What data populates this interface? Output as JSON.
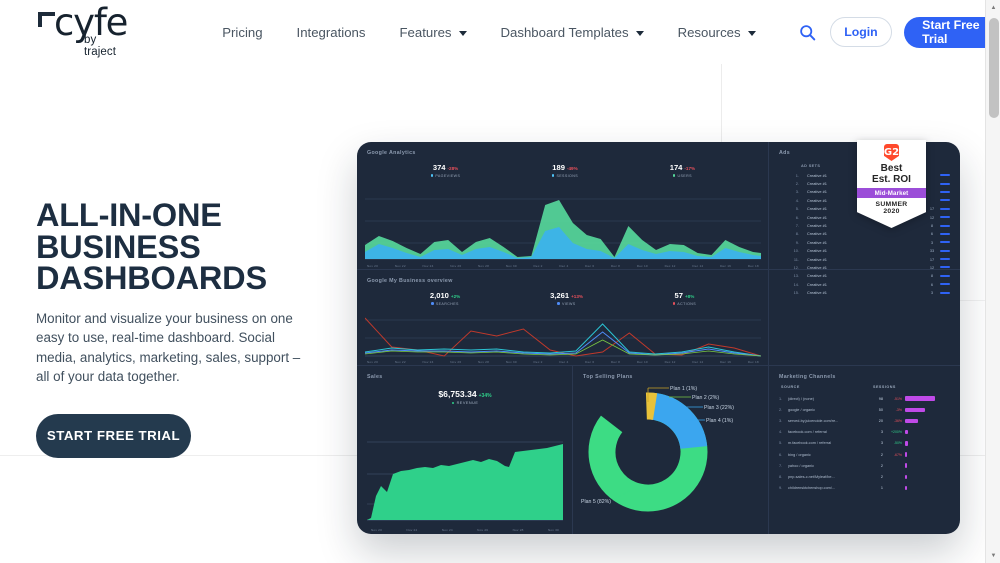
{
  "header": {
    "logo": {
      "text": "cyfe",
      "tagline": "by traject"
    },
    "nav": [
      {
        "label": "Pricing",
        "dropdown": false
      },
      {
        "label": "Integrations",
        "dropdown": false
      },
      {
        "label": "Features",
        "dropdown": true
      },
      {
        "label": "Dashboard Templates",
        "dropdown": true
      },
      {
        "label": "Resources",
        "dropdown": true
      }
    ],
    "search_icon": "search-icon",
    "login_label": "Login",
    "trial_label": "Start Free Trial",
    "trial_arrow": "→",
    "accent_color": "#2f62f5"
  },
  "hero": {
    "title_line1": "ALL-IN-ONE",
    "title_line2": "BUSINESS",
    "title_line3": "DASHBOARDS",
    "paragraph": "Monitor and visualize your business on one easy to use, real-time dashboard. Social media, analytics, marketing, sales, support – all of your data together.",
    "cta_label": "START FREE TRIAL",
    "cta_color": "#243a4e"
  },
  "badge": {
    "logo": "G2",
    "line1": "Best",
    "line2": "Est. ROI",
    "ribbon": "Mid-Market",
    "season": "SUMMER",
    "year": "2020",
    "ribbon_color": "#9b4dd8",
    "logo_color": "#ff492c"
  },
  "dashboard": {
    "background": "#1e293b",
    "google_analytics": {
      "title": "Google Analytics",
      "metrics": [
        {
          "value": "374",
          "change": "-28%",
          "direction": "down",
          "label": "PAGEVIEWS",
          "color": "#4fc3f7"
        },
        {
          "value": "189",
          "change": "-49%",
          "direction": "down",
          "label": "SESSIONS",
          "color": "#4fc3f7"
        },
        {
          "value": "174",
          "change": "-17%",
          "direction": "down",
          "label": "USERS",
          "color": "#56d79b"
        }
      ],
      "axis_labels": [
        "Nov 20",
        "Nov 22",
        "Nov 24",
        "Nov 26",
        "Nov 28",
        "Nov 30",
        "Dec 2",
        "Dec 4",
        "Dec 6",
        "Dec 8",
        "Dec 10",
        "Dec 12",
        "Dec 14",
        "Dec 16",
        "Dec 18"
      ]
    },
    "gmb": {
      "title": "Google My Business overview",
      "metrics": [
        {
          "value": "2,010",
          "change": "+2%",
          "direction": "up",
          "label": "SEARCHES",
          "color": "#4f8cf7"
        },
        {
          "value": "3,261",
          "change": "+13%",
          "direction": "up",
          "label": "VIEWS",
          "color": "#4f8cf7"
        },
        {
          "value": "57",
          "change": "+8%",
          "direction": "up",
          "label": "ACTIONS",
          "color": "#e8505b"
        }
      ],
      "axis_labels": [
        "Nov 20",
        "Nov 22",
        "Nov 24",
        "Nov 26",
        "Nov 28",
        "Nov 30",
        "Dec 2",
        "Dec 4",
        "Dec 6",
        "Dec 8",
        "Dec 10",
        "Dec 12",
        "Dec 14",
        "Dec 16",
        "Dec 18"
      ]
    },
    "ads": {
      "title": "Ads",
      "column_header": "AD SETS",
      "rows": [
        {
          "index": "1.",
          "name": "Creative #1",
          "count": ""
        },
        {
          "index": "2.",
          "name": "Creative #1",
          "count": ""
        },
        {
          "index": "3.",
          "name": "Creative #1",
          "count": ""
        },
        {
          "index": "4.",
          "name": "Creative #1",
          "count": ""
        },
        {
          "index": "5.",
          "name": "Creative #1",
          "count": "17"
        },
        {
          "index": "6.",
          "name": "Creative #1",
          "count": "12"
        },
        {
          "index": "7.",
          "name": "Creative #1",
          "count": "8"
        },
        {
          "index": "8.",
          "name": "Creative #1",
          "count": "6"
        },
        {
          "index": "9.",
          "name": "Creative #1",
          "count": "3"
        },
        {
          "index": "10.",
          "name": "Creative #1",
          "count": "33"
        },
        {
          "index": "11.",
          "name": "Creative #1",
          "count": "17"
        },
        {
          "index": "12.",
          "name": "Creative #1",
          "count": "12"
        },
        {
          "index": "13.",
          "name": "Creative #1",
          "count": "8"
        },
        {
          "index": "14.",
          "name": "Creative #1",
          "count": "6"
        },
        {
          "index": "15.",
          "name": "Creative #1",
          "count": "3"
        }
      ]
    },
    "sales": {
      "title": "Sales",
      "value": "$6,753.34",
      "change": "+34%",
      "direction": "up",
      "label": "REVENUE",
      "color": "#2fd08a",
      "axis_labels": [
        "Nov 20",
        "Nov 22",
        "Nov 24",
        "Nov 26",
        "Nov 28",
        "Nov 30"
      ]
    },
    "top_plans": {
      "title": "Top Selling  Plans",
      "labels": [
        {
          "text": "Plan 1 (1%)",
          "color": "#e8c23a"
        },
        {
          "text": "Plan 2 (2%)",
          "color": "#7ac943"
        },
        {
          "text": "Plan 3 (22%)",
          "color": "#3ba6ef"
        },
        {
          "text": "Plan 4 (1%)",
          "color": "#3ba6ef"
        },
        {
          "text": "Plan 5 (82%)",
          "color": "#3ddc84"
        }
      ]
    },
    "marketing": {
      "title": "Marketing  Channels",
      "col_source": "SOURCE",
      "col_sessions": "SESSIONS",
      "rows": [
        {
          "index": "1.",
          "source": "(direct) / (none)",
          "sessions": "98",
          "pct": "-51%",
          "direction": "down",
          "bar": 30
        },
        {
          "index": "2.",
          "source": "google / organic",
          "sessions": "50",
          "pct": "-3%",
          "direction": "down",
          "bar": 20
        },
        {
          "index": "3.",
          "source": "served-by.juicenoide.com/re...",
          "sessions": "20",
          "pct": "-36%",
          "direction": "down",
          "bar": 13
        },
        {
          "index": "4.",
          "source": "facebook.com / referral",
          "sessions": "3",
          "pct": "+200%",
          "direction": "up",
          "bar": 2.5
        },
        {
          "index": "5.",
          "source": "m.facebook.com / referral",
          "sessions": "3",
          "pct": "-50%",
          "direction": "down",
          "bar": 2.5
        },
        {
          "index": "6.",
          "source": "bing / organic",
          "sessions": "2",
          "pct": "-67%",
          "direction": "down",
          "bar": 2
        },
        {
          "index": "7.",
          "source": "yahoo / organic",
          "sessions": "2",
          "pct": "",
          "direction": "none",
          "bar": 2
        },
        {
          "index": "8.",
          "source": "pnp-sales-c.net/Myleaf/be...",
          "sessions": "2",
          "pct": "",
          "direction": "none",
          "bar": 2
        },
        {
          "index": "9.",
          "source": "childrensktchenshop.com/...",
          "sessions": "1",
          "pct": "",
          "direction": "none",
          "bar": 1.5
        }
      ]
    }
  },
  "scrollbar": {
    "up_glyph": "▲",
    "down_glyph": "▼"
  },
  "chart_data": [
    {
      "type": "area",
      "title": "Google Analytics",
      "xlabel": "",
      "ylabel": "",
      "x": [
        "Nov 20",
        "Nov 21",
        "Nov 22",
        "Nov 23",
        "Nov 24",
        "Nov 25",
        "Nov 26",
        "Nov 27",
        "Nov 28",
        "Nov 29",
        "Nov 30",
        "Dec 1",
        "Dec 2",
        "Dec 3",
        "Dec 4",
        "Dec 5",
        "Dec 6",
        "Dec 7",
        "Dec 8",
        "Dec 9",
        "Dec 10",
        "Dec 11",
        "Dec 12",
        "Dec 13",
        "Dec 14",
        "Dec 15",
        "Dec 16",
        "Dec 17",
        "Dec 18"
      ],
      "series": [
        {
          "name": "PAGEVIEWS",
          "color": "#56d79b",
          "values": [
            20,
            38,
            30,
            18,
            8,
            30,
            34,
            12,
            30,
            36,
            18,
            5,
            6,
            74,
            86,
            52,
            38,
            34,
            8,
            48,
            30,
            16,
            26,
            24,
            10,
            8,
            34,
            22,
            14
          ]
        },
        {
          "name": "SESSIONS",
          "color": "#4fc3f7",
          "values": [
            10,
            24,
            18,
            10,
            4,
            14,
            16,
            6,
            16,
            20,
            10,
            3,
            3,
            50,
            60,
            34,
            24,
            20,
            4,
            26,
            16,
            8,
            14,
            12,
            5,
            4,
            20,
            12,
            8
          ]
        }
      ],
      "grid": true,
      "legend": "top",
      "ylim": [
        0,
        100
      ]
    },
    {
      "type": "line",
      "title": "Google My Business overview",
      "x": [
        "Nov 20",
        "Nov 22",
        "Nov 24",
        "Nov 26",
        "Nov 28",
        "Nov 30",
        "Dec 2",
        "Dec 4",
        "Dec 6",
        "Dec 8",
        "Dec 10",
        "Dec 12",
        "Dec 14",
        "Dec 16",
        "Dec 18"
      ],
      "series": [
        {
          "name": "SEARCHES",
          "color": "#4f8cf7",
          "values": [
            12,
            10,
            10,
            9,
            10,
            8,
            6,
            20,
            7,
            6,
            10,
            8,
            9,
            5,
            3
          ]
        },
        {
          "name": "VIEWS",
          "color": "#2bc4d4",
          "values": [
            14,
            11,
            11,
            10,
            11,
            9,
            7,
            34,
            8,
            7,
            12,
            9,
            10,
            6,
            3
          ]
        },
        {
          "name": "ACTIONS",
          "color": "#c0392b",
          "values": [
            60,
            18,
            12,
            36,
            28,
            34,
            8,
            30,
            6,
            4,
            22,
            8,
            18,
            6,
            2
          ]
        }
      ],
      "grid": true,
      "legend": "top"
    },
    {
      "type": "area",
      "title": "Sales",
      "x": [
        "Nov 20",
        "Nov 21",
        "Nov 22",
        "Nov 23",
        "Nov 24",
        "Nov 25",
        "Nov 26",
        "Nov 27",
        "Nov 28",
        "Nov 29",
        "Nov 30"
      ],
      "series": [
        {
          "name": "REVENUE",
          "color": "#2fd08a",
          "values": [
            5,
            42,
            36,
            52,
            60,
            62,
            66,
            70,
            68,
            78,
            86
          ]
        }
      ],
      "grid": true,
      "legend": "top"
    },
    {
      "type": "pie",
      "title": "Top Selling  Plans",
      "labels": [
        "Plan 1",
        "Plan 2",
        "Plan 3",
        "Plan 4",
        "Plan 5"
      ],
      "values": [
        1,
        2,
        22,
        1,
        82
      ],
      "display_labels": [
        "Plan 1 (1%)",
        "Plan 2 (2%)",
        "Plan 3 (22%)",
        "Plan 4 (1%)",
        "Plan 5 (82%)"
      ],
      "colors": [
        "#e8c23a",
        "#7ac943",
        "#3ba6ef",
        "#2e86c8",
        "#3ddc84"
      ],
      "legend": "right"
    },
    {
      "type": "table",
      "title": "Marketing  Channels",
      "columns": [
        "SOURCE",
        "SESSIONS"
      ],
      "rows": [
        [
          "(direct) / (none)",
          98
        ],
        [
          "google / organic",
          50
        ],
        [
          "served-by.juicenoide.com/re...",
          20
        ],
        [
          "facebook.com / referral",
          3
        ],
        [
          "m.facebook.com / referral",
          3
        ],
        [
          "bing / organic",
          2
        ],
        [
          "yahoo / organic",
          2
        ],
        [
          "pnp-sales-c.net/Myleaf/be...",
          2
        ],
        [
          "childrensktchenshop.com/...",
          1
        ]
      ]
    },
    {
      "type": "table",
      "title": "Ads",
      "columns": [
        "AD SETS"
      ],
      "rows": [
        [
          "Creative #1",
          ""
        ],
        [
          "Creative #1",
          ""
        ],
        [
          "Creative #1",
          ""
        ],
        [
          "Creative #1",
          ""
        ],
        [
          "Creative #1",
          17
        ],
        [
          "Creative #1",
          12
        ],
        [
          "Creative #1",
          8
        ],
        [
          "Creative #1",
          6
        ],
        [
          "Creative #1",
          3
        ],
        [
          "Creative #1",
          33
        ],
        [
          "Creative #1",
          17
        ],
        [
          "Creative #1",
          12
        ],
        [
          "Creative #1",
          8
        ],
        [
          "Creative #1",
          6
        ],
        [
          "Creative #1",
          3
        ]
      ]
    }
  ]
}
